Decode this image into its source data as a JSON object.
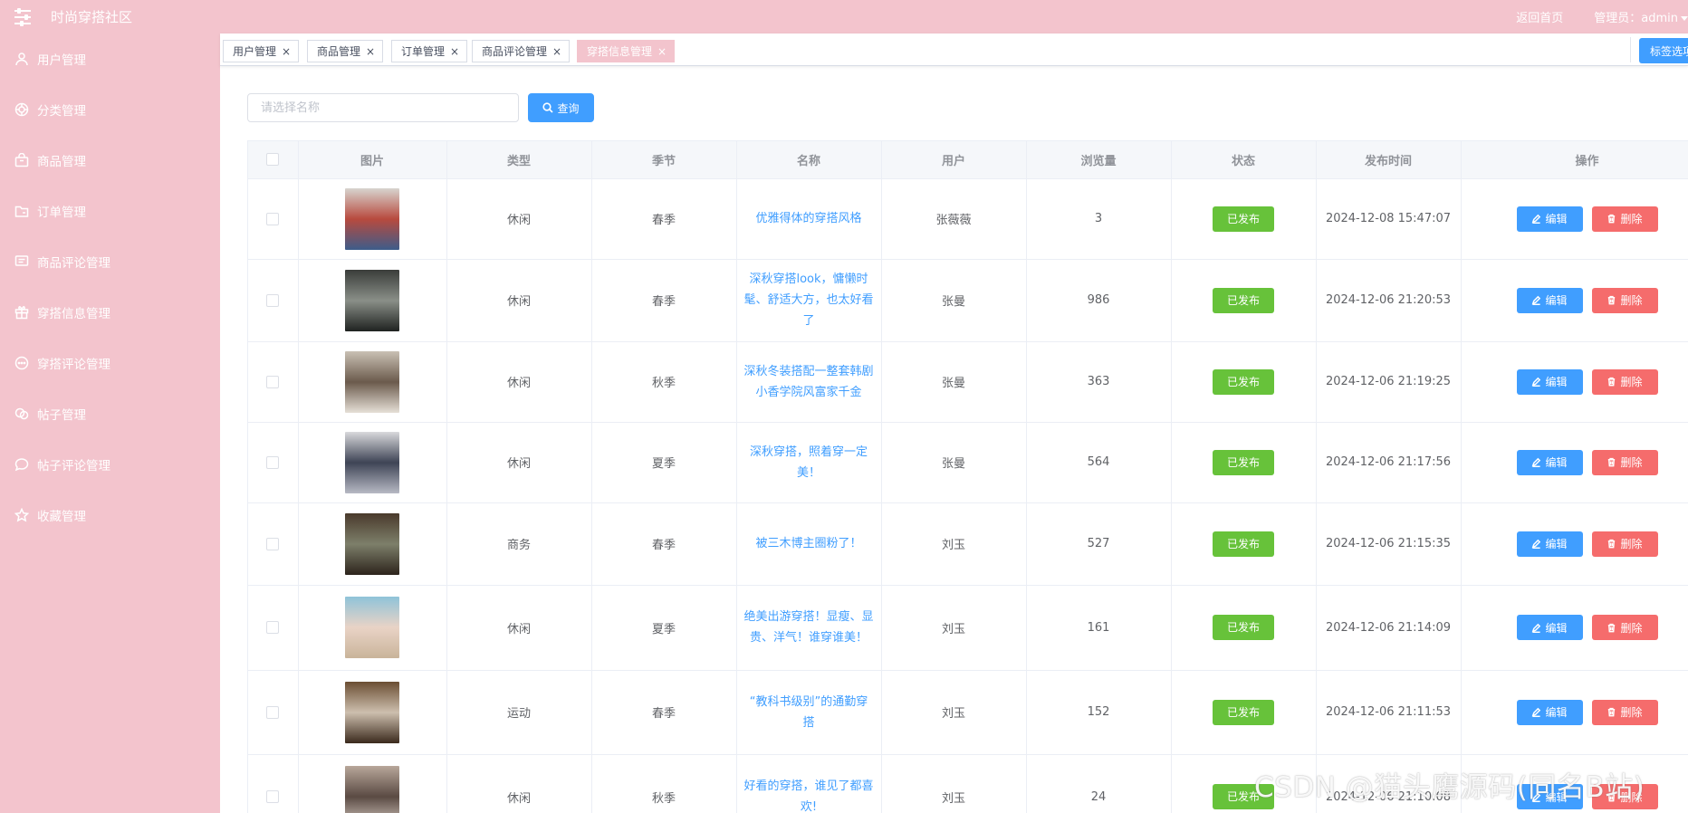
{
  "header": {
    "title": "时尚穿搭社区",
    "home_link": "返回首页",
    "admin_label": "管理员：admin"
  },
  "sidebar": {
    "items": [
      {
        "label": "用户管理",
        "icon": "user-icon"
      },
      {
        "label": "分类管理",
        "icon": "category-icon"
      },
      {
        "label": "商品管理",
        "icon": "goods-icon"
      },
      {
        "label": "订单管理",
        "icon": "order-icon"
      },
      {
        "label": "商品评论管理",
        "icon": "comment-icon"
      },
      {
        "label": "穿搭信息管理",
        "icon": "gift-icon"
      },
      {
        "label": "穿搭评论管理",
        "icon": "chat-dots-icon"
      },
      {
        "label": "帖子管理",
        "icon": "post-icon"
      },
      {
        "label": "帖子评论管理",
        "icon": "chat-bubble-icon"
      },
      {
        "label": "收藏管理",
        "icon": "star-icon"
      }
    ]
  },
  "tabs": [
    {
      "label": "用户管理",
      "close": "×",
      "active": false
    },
    {
      "label": "商品管理",
      "close": "×",
      "active": false
    },
    {
      "label": "订单管理",
      "close": "×",
      "active": false
    },
    {
      "label": "商品评论管理",
      "close": "×",
      "active": false
    },
    {
      "label": "穿搭信息管理",
      "close": "×",
      "active": true
    }
  ],
  "tab_ops_label": "标签选项",
  "search": {
    "placeholder": "请选择名称",
    "button_label": "查询"
  },
  "table": {
    "columns": [
      "图片",
      "类型",
      "季节",
      "名称",
      "用户",
      "浏览量",
      "状态",
      "发布时间",
      "操作"
    ],
    "edit_label": "编辑",
    "delete_label": "删除",
    "rows": [
      {
        "type": "休闲",
        "season": "春季",
        "name": "优雅得体的穿搭风格",
        "user": "张薇薇",
        "views": "3",
        "status": "已发布",
        "time": "2024-12-08 15:47:07",
        "colors": [
          "#d7d4cf",
          "#b84a3e",
          "#3d5c8a"
        ]
      },
      {
        "type": "休闲",
        "season": "春季",
        "name": "深秋穿搭look，慵懒时髦、舒适大方，也太好看了",
        "user": "张曼",
        "views": "986",
        "status": "已发布",
        "time": "2024-12-06 21:20:53",
        "colors": [
          "#3a3d3a",
          "#8a8f88",
          "#1f2220"
        ]
      },
      {
        "type": "休闲",
        "season": "秋季",
        "name": "深秋冬装搭配一整套韩剧小香学院风富家千金",
        "user": "张曼",
        "views": "363",
        "status": "已发布",
        "time": "2024-12-06 21:19:25",
        "colors": [
          "#c9c0b4",
          "#6b5a4c",
          "#e6e0d7"
        ]
      },
      {
        "type": "休闲",
        "season": "夏季",
        "name": "深秋穿搭，照着穿一定美！",
        "user": "张曼",
        "views": "564",
        "status": "已发布",
        "time": "2024-12-06 21:17:56",
        "colors": [
          "#d9d9dc",
          "#3e4455",
          "#b7b9c4"
        ]
      },
      {
        "type": "商务",
        "season": "春季",
        "name": "被三木博主圈粉了！",
        "user": "刘玉",
        "views": "527",
        "status": "已发布",
        "time": "2024-12-06 21:15:35",
        "colors": [
          "#4a3a2c",
          "#7d7f6a",
          "#2d241c"
        ]
      },
      {
        "type": "休闲",
        "season": "夏季",
        "name": "绝美出游穿搭！显瘦、显贵、洋气！谁穿谁美！",
        "user": "刘玉",
        "views": "161",
        "status": "已发布",
        "time": "2024-12-06 21:14:09",
        "colors": [
          "#8fc3d9",
          "#e9d3c6",
          "#c9b49a"
        ]
      },
      {
        "type": "运动",
        "season": "春季",
        "name": "“教科书级别”的通勤穿搭",
        "user": "刘玉",
        "views": "152",
        "status": "已发布",
        "time": "2024-12-06 21:11:53",
        "colors": [
          "#6b4e33",
          "#cdbfae",
          "#3b2a1d"
        ]
      },
      {
        "type": "休闲",
        "season": "秋季",
        "name": "好看的穿搭，谁见了都喜欢!",
        "user": "刘玉",
        "views": "24",
        "status": "已发布",
        "time": "2024-12-06 21:10:08",
        "colors": [
          "#b8a79a",
          "#5a4a43",
          "#d8cdc4"
        ]
      }
    ]
  },
  "watermark": "CSDN @猫头鹰源码(同名B站)"
}
